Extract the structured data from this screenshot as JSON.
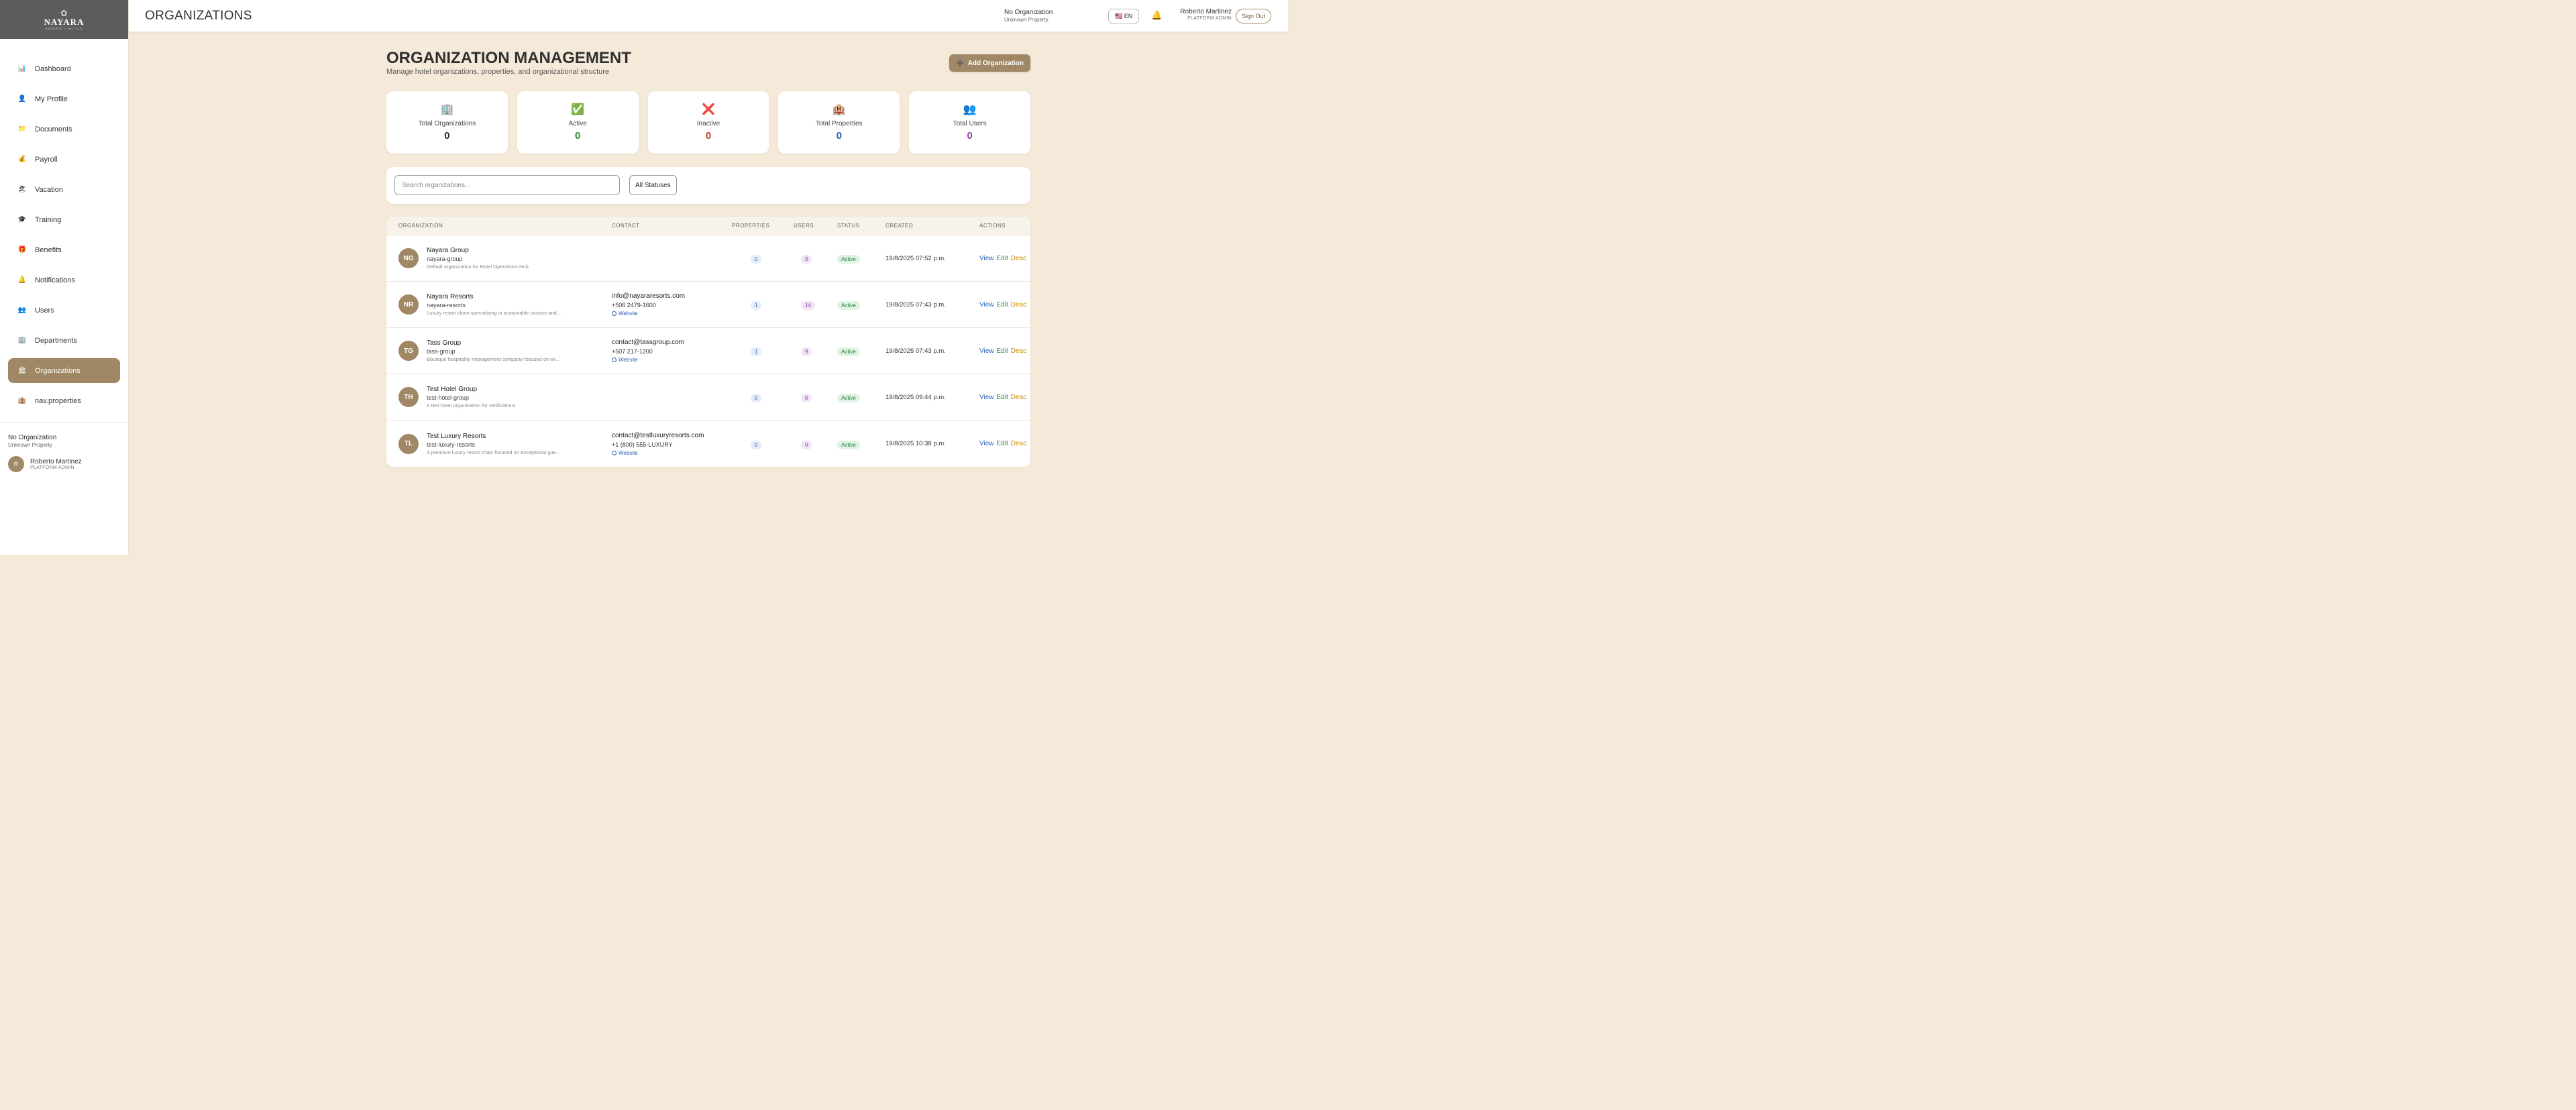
{
  "brand": {
    "name": "NAYARA",
    "tagline": "RESORTS + HOTELS"
  },
  "sidebar": {
    "items": [
      {
        "label": "Dashboard",
        "icon": "📊"
      },
      {
        "label": "My Profile",
        "icon": "👤"
      },
      {
        "label": "Documents",
        "icon": "📁"
      },
      {
        "label": "Payroll",
        "icon": "💰"
      },
      {
        "label": "Vacation",
        "icon": "🏖"
      },
      {
        "label": "Training",
        "icon": "🎓"
      },
      {
        "label": "Benefits",
        "icon": "🎁"
      },
      {
        "label": "Notifications",
        "icon": "🔔"
      },
      {
        "label": "Users",
        "icon": "👥"
      },
      {
        "label": "Departments",
        "icon": "🏢"
      },
      {
        "label": "Organizations",
        "icon": "🏛"
      },
      {
        "label": "nav.properties",
        "icon": "🏨"
      }
    ],
    "active_index": 10,
    "footer": {
      "organization": "No Organization",
      "property": "Unknown Property",
      "user_initial": "R",
      "user_name": "Roberto Martinez",
      "user_role": "PLATFORM ADMIN"
    }
  },
  "header": {
    "title": "ORGANIZATIONS",
    "organization": "No Organization",
    "property": "Unknown Property",
    "language": "🇺🇸 EN",
    "user_name": "Roberto Martinez",
    "user_role": "PLATFORM ADMIN",
    "sign_out": "Sign Out"
  },
  "page": {
    "title": "ORGANIZATION MANAGEMENT",
    "subtitle": "Manage hotel organizations, properties, and organizational structure",
    "add_button": "Add Organization"
  },
  "stats": [
    {
      "label": "Total Organizations",
      "value": "0",
      "icon": "🏢",
      "color": "#2f2f2f"
    },
    {
      "label": "Active",
      "value": "0",
      "icon": "✅",
      "color": "#2e8a3e"
    },
    {
      "label": "Inactive",
      "value": "0",
      "icon": "❌",
      "color": "#c0392b"
    },
    {
      "label": "Total Properties",
      "value": "0",
      "icon": "🏨",
      "color": "#2a5fb0"
    },
    {
      "label": "Total Users",
      "value": "0",
      "icon": "👥",
      "color": "#8e44ad"
    }
  ],
  "filters": {
    "search_placeholder": "Search organizations...",
    "status_value": "All Statuses"
  },
  "table": {
    "headers": {
      "organization": "ORGANIZATION",
      "contact": "CONTACT",
      "properties": "PROPERTIES",
      "users": "USERS",
      "status": "STATUS",
      "created": "CREATED",
      "actions": "ACTIONS"
    },
    "actions": {
      "view": "View",
      "edit": "Edit",
      "deactivate": "Deac"
    },
    "website_label": "Website",
    "rows": [
      {
        "initials": "NG",
        "name": "Nayara Group",
        "slug": "nayara-group",
        "description": "Default organization for Hotel Operations Hub",
        "email": "",
        "phone": "",
        "website": "",
        "properties": "0",
        "users": "0",
        "status": "Active",
        "created": "19/8/2025 07:52 p.m."
      },
      {
        "initials": "NR",
        "name": "Nayara Resorts",
        "slug": "nayara-resorts",
        "description": "Luxury resort chain specializing in sustainable tourism and...",
        "email": "info@nayararesorts.com",
        "phone": "+506 2479-1600",
        "website": "Website",
        "properties": "1",
        "users": "14",
        "status": "Active",
        "created": "19/8/2025 07:43 p.m."
      },
      {
        "initials": "TG",
        "name": "Tass Group",
        "slug": "tass-group",
        "description": "Boutique hospitality management company focused on ex...",
        "email": "contact@tassgroup.com",
        "phone": "+507 217-1200",
        "website": "Website",
        "properties": "1",
        "users": "9",
        "status": "Active",
        "created": "19/8/2025 07:43 p.m."
      },
      {
        "initials": "TH",
        "name": "Test Hotel Group",
        "slug": "test-hotel-group",
        "description": "A test hotel organization for verifications",
        "email": "",
        "phone": "",
        "website": "",
        "properties": "0",
        "users": "0",
        "status": "Active",
        "created": "19/8/2025 09:44 p.m."
      },
      {
        "initials": "TL",
        "name": "Test Luxury Resorts",
        "slug": "test-luxury-resorts",
        "description": "A premium luxury resort chain focused on exceptional gue...",
        "email": "contact@testluxuryresorts.com",
        "phone": "+1 (800) 555-LUXURY",
        "website": "Website",
        "properties": "0",
        "users": "0",
        "status": "Active",
        "created": "19/8/2025 10:38 p.m."
      }
    ]
  }
}
